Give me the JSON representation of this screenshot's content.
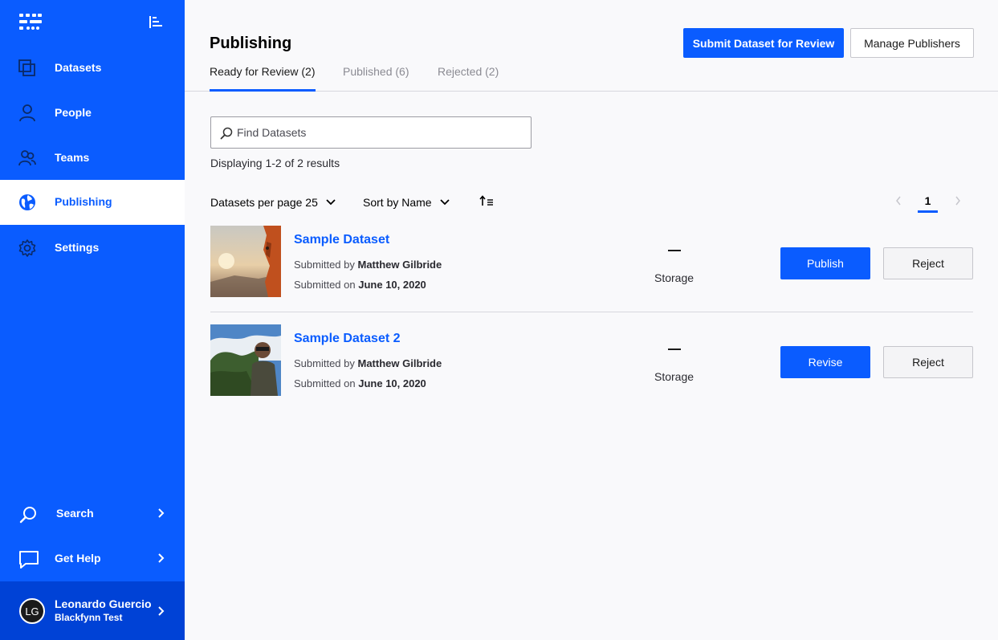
{
  "sidebar": {
    "logo_icon": "app-logo-icon",
    "collapse_icon": "collapse-menu-icon",
    "items": [
      {
        "label": "Datasets",
        "icon": "datasets-icon"
      },
      {
        "label": "People",
        "icon": "person-icon"
      },
      {
        "label": "Teams",
        "icon": "team-icon"
      },
      {
        "label": "Publishing",
        "icon": "globe-icon",
        "active": true
      },
      {
        "label": "Settings",
        "icon": "gear-icon"
      }
    ],
    "bottom": [
      {
        "label": "Search",
        "icon": "search-icon"
      },
      {
        "label": "Get Help",
        "icon": "chat-icon"
      }
    ],
    "user": {
      "initials": "LG",
      "name": "Leonardo Guercio",
      "org": "Blackfynn Test"
    }
  },
  "header": {
    "title": "Publishing",
    "submit_label": "Submit Dataset for Review",
    "manage_label": "Manage Publishers",
    "tabs": [
      {
        "label": "Ready for Review (2)",
        "active": true
      },
      {
        "label": "Published (6)"
      },
      {
        "label": "Rejected (2)"
      }
    ]
  },
  "main": {
    "search_placeholder": "Find Datasets",
    "results_text": "Displaying 1-2 of 2 results",
    "per_page_label": "Datasets per page 25",
    "sort_label": "Sort by Name",
    "current_page": "1",
    "datasets": [
      {
        "title": "Sample Dataset",
        "submitted_by_prefix": "Submitted by",
        "submitted_by": "Matthew Gilbride",
        "submitted_on_prefix": "Submitted on",
        "submitted_on": "June 10, 2020",
        "storage_value": "—",
        "storage_label": "Storage",
        "action_label": "Publish",
        "reject_label": "Reject"
      },
      {
        "title": "Sample Dataset 2",
        "submitted_by_prefix": "Submitted by",
        "submitted_by": "Matthew Gilbride",
        "submitted_on_prefix": "Submitted on",
        "submitted_on": "June 10, 2020",
        "storage_value": "—",
        "storage_label": "Storage",
        "action_label": "Revise",
        "reject_label": "Reject"
      }
    ]
  },
  "colors": {
    "brand": "#0a5cff",
    "sidebar_bottom": "#0042d6",
    "page_bg": "#f9f9fb"
  }
}
